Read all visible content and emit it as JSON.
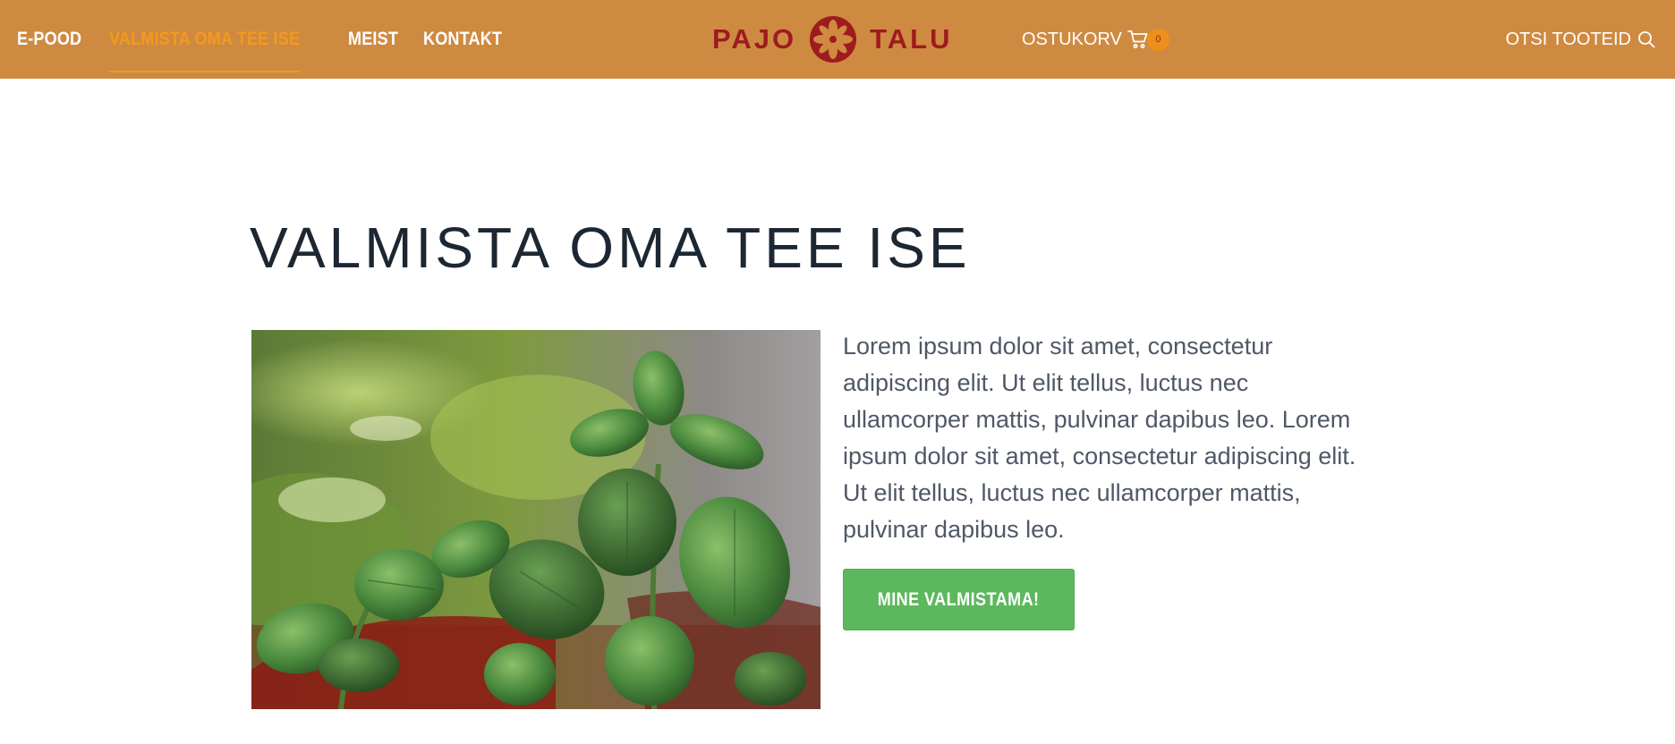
{
  "colors": {
    "header_bg": "#cf8a41",
    "nav_active": "#f39a1c",
    "logo": "#9e1b1f",
    "cart_badge": "#ef8f1b",
    "title": "#1c2733",
    "body_text": "#4f5867",
    "button": "#5cb85c"
  },
  "nav": {
    "items": [
      {
        "label": "E-POOD",
        "active": false
      },
      {
        "label": "VALMISTA OMA TEE ISE",
        "active": true
      },
      {
        "label": "MEIST",
        "active": false
      },
      {
        "label": "KONTAKT",
        "active": false
      }
    ]
  },
  "logo": {
    "left": "PAJO",
    "right": "TALU",
    "icon": "flower-emblem-icon"
  },
  "cart": {
    "label": "OSTUKORV",
    "count": "0",
    "icon": "cart-icon"
  },
  "search": {
    "label": "OTSI TOOTEID",
    "icon": "search-icon"
  },
  "main": {
    "title": "VALMISTA OMA TEE ISE",
    "image": "mint-plant-photo",
    "body": "Lorem ipsum dolor sit amet, consectetur adipiscing elit. Ut elit tellus, luctus nec ullamcorper mattis, pulvinar dapibus leo. Lorem ipsum dolor sit amet, consectetur adipiscing elit. Ut elit tellus, luctus nec ullamcorper mattis, pulvinar dapibus leo.",
    "button_label": "MINE VALMISTAMA!"
  }
}
